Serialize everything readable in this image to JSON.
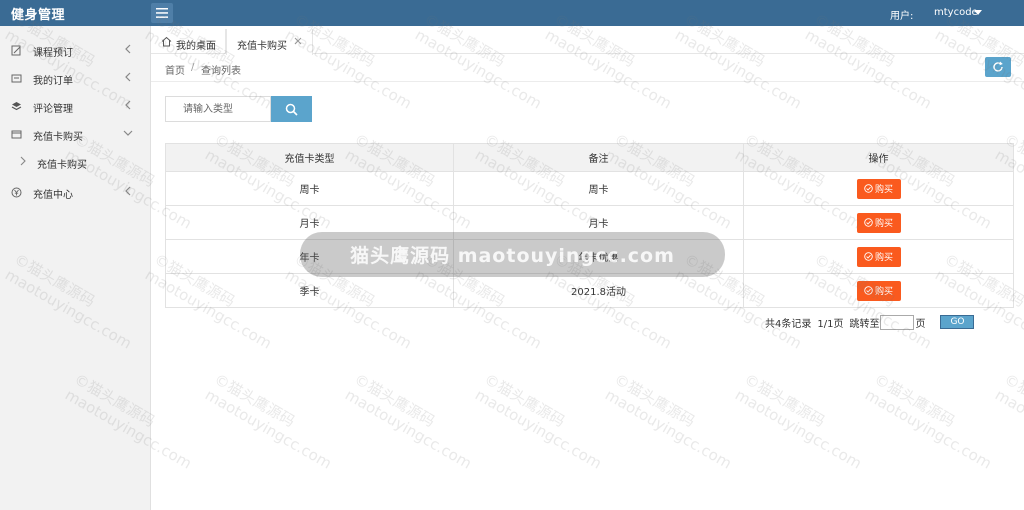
{
  "header": {
    "app_title": "健身管理",
    "user_label": "用户:",
    "user_name": "mtycode"
  },
  "sidebar": {
    "items": [
      {
        "label": "课程预订",
        "icon": "edit-icon"
      },
      {
        "label": "我的订单",
        "icon": "orders-icon"
      },
      {
        "label": "评论管理",
        "icon": "layers-icon"
      },
      {
        "label": "充值卡购买",
        "icon": "card-icon",
        "expanded": true,
        "children": [
          {
            "label": "充值卡购买"
          }
        ]
      },
      {
        "label": "充值中心",
        "icon": "yen-icon"
      }
    ]
  },
  "tabs": {
    "home_label": "我的桌面",
    "active_label": "充值卡购买"
  },
  "breadcrumb": {
    "home": "首页",
    "separator": "/",
    "current": "查询列表"
  },
  "search": {
    "placeholder": "请输入类型",
    "value": ""
  },
  "table": {
    "headers": [
      "充值卡类型",
      "备注",
      "操作"
    ],
    "rows": [
      {
        "type": "周卡",
        "note": "周卡",
        "action": "购买"
      },
      {
        "type": "月卡",
        "note": "月卡",
        "action": "购买"
      },
      {
        "type": "年卡",
        "note": "年卡优惠",
        "action": "购买"
      },
      {
        "type": "季卡",
        "note": "2021.8活动",
        "action": "购买"
      }
    ]
  },
  "pager": {
    "total": "共4条记录",
    "pages": "1/1页",
    "jump_label": "跳转至",
    "page_unit": "页",
    "go_label": "GO",
    "jump_value": ""
  },
  "watermark": {
    "line1": "©猫头鹰源码",
    "line2": "maotouyingcc.com",
    "center": "猫头鹰源码 maotouyingcc.com"
  },
  "colors": {
    "header_bg": "#3a6b94",
    "accent": "#5ba4cc",
    "buy_button": "#fa5a1e",
    "sidebar_bg": "#f2f2f2"
  }
}
